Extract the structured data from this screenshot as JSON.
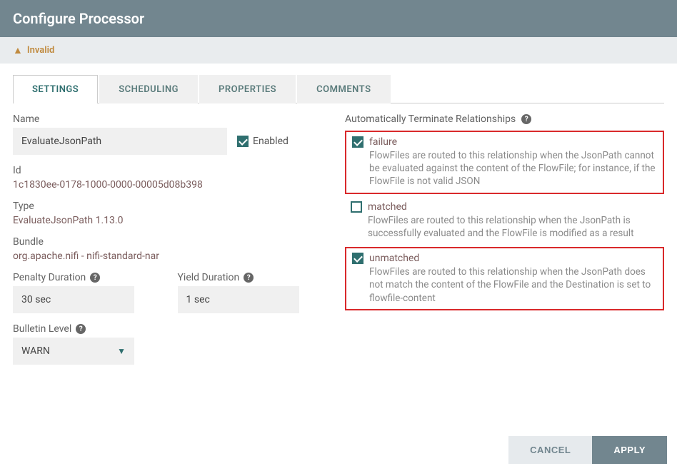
{
  "header": {
    "title": "Configure Processor"
  },
  "status": {
    "text": "Invalid",
    "icon": "warning-icon"
  },
  "tabs": {
    "settings": "SETTINGS",
    "scheduling": "SCHEDULING",
    "properties": "PROPERTIES",
    "comments": "COMMENTS",
    "active": "settings"
  },
  "fields": {
    "name_label": "Name",
    "name_value": "EvaluateJsonPath",
    "enabled_label": "Enabled",
    "enabled_checked": true,
    "id_label": "Id",
    "id_value": "1c1830ee-0178-1000-0000-00005d08b398",
    "type_label": "Type",
    "type_value": "EvaluateJsonPath 1.13.0",
    "bundle_label": "Bundle",
    "bundle_value": "org.apache.nifi - nifi-standard-nar",
    "penalty_label": "Penalty Duration",
    "penalty_value": "30 sec",
    "yield_label": "Yield Duration",
    "yield_value": "1 sec",
    "bulletin_label": "Bulletin Level",
    "bulletin_value": "WARN"
  },
  "relationships": {
    "header": "Automatically Terminate Relationships",
    "items": [
      {
        "name": "failure",
        "checked": true,
        "highlighted": true,
        "desc": "FlowFiles are routed to this relationship when the JsonPath cannot be evaluated against the content of the FlowFile; for instance, if the FlowFile is not valid JSON"
      },
      {
        "name": "matched",
        "checked": false,
        "highlighted": false,
        "desc": "FlowFiles are routed to this relationship when the JsonPath is successfully evaluated and the FlowFile is modified as a result"
      },
      {
        "name": "unmatched",
        "checked": true,
        "highlighted": true,
        "desc": "FlowFiles are routed to this relationship when the JsonPath does not match the content of the FlowFile and the Destination is set to flowfile-content"
      }
    ]
  },
  "buttons": {
    "cancel": "CANCEL",
    "apply": "APPLY"
  }
}
